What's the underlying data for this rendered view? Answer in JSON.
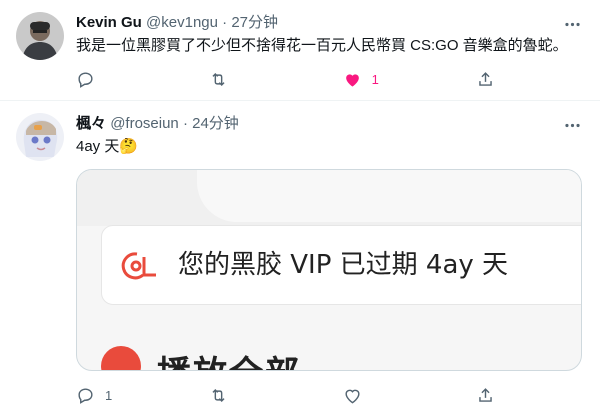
{
  "colors": {
    "like": "#f91880",
    "secondary": "#536471",
    "border": "#eff3f4",
    "brand_red": "#e94b3c"
  },
  "tweets": [
    {
      "name": "Kevin Gu",
      "handle": "@kev1ngu",
      "dot": "·",
      "time": "27分钟",
      "text": "我是一位黑膠買了不少但不捨得花一百元人民幣買 CS:GO 音樂盒的魯蛇。",
      "actions": {
        "reply": "",
        "retweet": "",
        "like": "1",
        "share": ""
      },
      "liked": true
    },
    {
      "name": "楓々",
      "handle": "@froseiun",
      "dot": "·",
      "time": "24分钟",
      "text": "4ay 天",
      "emoji": "🤔",
      "media": {
        "card_text": "您的黑胶 VIP 已过期 4ay 天",
        "cut_text": "播放全部"
      },
      "actions": {
        "reply": "1",
        "retweet": "",
        "like": "",
        "share": ""
      },
      "liked": false
    }
  ]
}
